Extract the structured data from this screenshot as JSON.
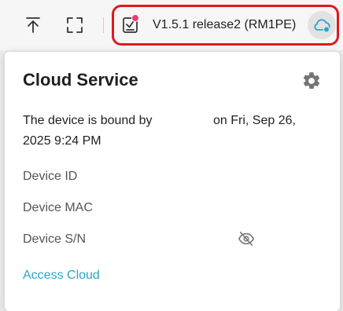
{
  "toolbar": {
    "version_label": "V1.5.1 release2 (RM1PE)"
  },
  "panel": {
    "title": "Cloud Service",
    "bound_text_line1": "The device is bound by",
    "bound_date_part": "on Fri, Sep 26,",
    "bound_text_line2": "2025 9:24 PM",
    "fields": [
      {
        "label": "Device ID"
      },
      {
        "label": "Device MAC"
      },
      {
        "label": "Device S/N"
      }
    ],
    "access_link": "Access Cloud"
  },
  "colors": {
    "accent": "#2aa6c6",
    "highlight_border": "#e0191e",
    "update_dot": "#e93e74"
  },
  "icons": {
    "upload": "upload-icon",
    "fullscreen": "fullscreen-icon",
    "update": "firmware-update-icon",
    "cloud": "cloud-status-icon",
    "settings": "gear-icon",
    "hidden": "eye-slash-icon"
  }
}
